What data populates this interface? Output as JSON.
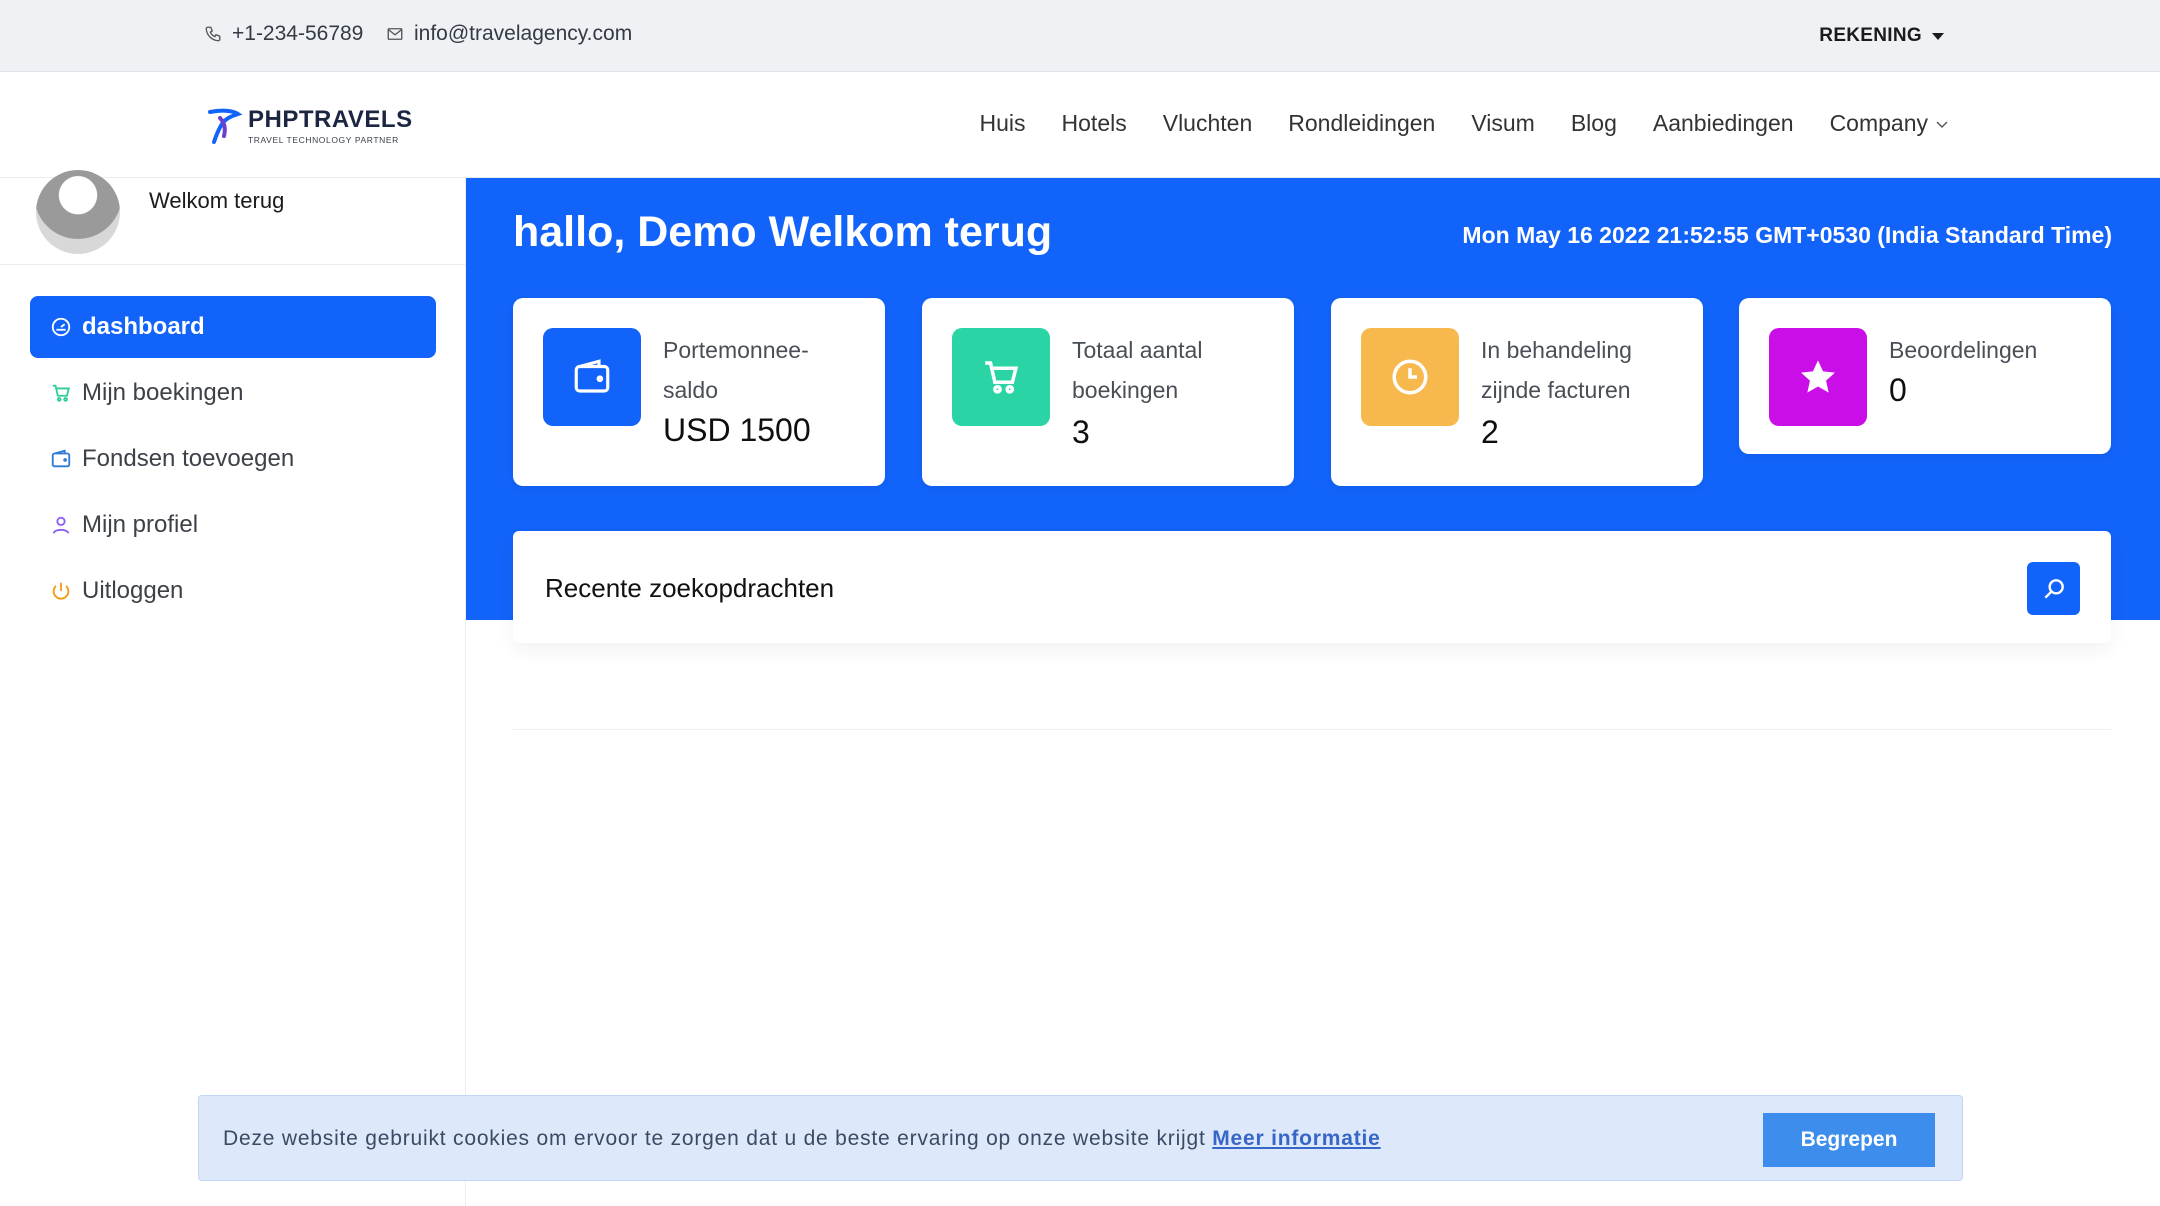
{
  "topbar": {
    "phone": "+1-234-56789",
    "email": "info@travelagency.com",
    "account_label": "REKENING"
  },
  "brand": {
    "name": "PHPTRAVELS",
    "tagline": "TRAVEL TECHNOLOGY PARTNER",
    "accent_color": "#1263f9"
  },
  "nav": {
    "items": [
      "Huis",
      "Hotels",
      "Vluchten",
      "Rondleidingen",
      "Visum",
      "Blog",
      "Aanbiedingen",
      "Company"
    ]
  },
  "sidebar": {
    "welcome": "Welkom terug",
    "items": [
      {
        "label": "dashboard",
        "icon": "speedometer-icon",
        "active": true
      },
      {
        "label": "Mijn boekingen",
        "icon": "cart-icon",
        "color": "#2ecc9a"
      },
      {
        "label": "Fondsen toevoegen",
        "icon": "wallet-icon",
        "color": "#2e7bd6"
      },
      {
        "label": "Mijn profiel",
        "icon": "user-icon",
        "color": "#8b5cf6"
      },
      {
        "label": "Uitloggen",
        "icon": "power-icon",
        "color": "#f39c12"
      }
    ]
  },
  "main": {
    "greeting": "hallo, Demo Welkom terug",
    "datetime": "Mon May 16 2022 21:52:55 GMT+0530 (India Standard Time)",
    "cards": [
      {
        "label": "Portemonnee-saldo",
        "value": "USD 1500",
        "icon": "wallet-icon",
        "color": "#1263f9"
      },
      {
        "label": "Totaal aantal boekingen",
        "value": "3",
        "icon": "cart-icon",
        "color": "#2bd4a4"
      },
      {
        "label": "In behandeling zijnde facturen",
        "value": "2",
        "icon": "clock-icon",
        "color": "#f7b94d"
      },
      {
        "label": "Beoordelingen",
        "value": "0",
        "icon": "star-icon",
        "color": "#c90ee8"
      }
    ],
    "recent_searches_title": "Recente zoekopdrachten"
  },
  "cookie": {
    "text": "Deze website gebruikt cookies om ervoor te zorgen dat u de beste ervaring op onze website krijgt",
    "link": "Meer informatie",
    "button": "Begrepen"
  }
}
